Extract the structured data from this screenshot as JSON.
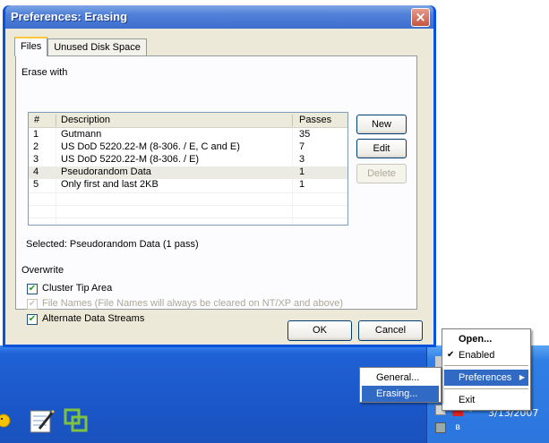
{
  "window": {
    "title": "Preferences: Erasing",
    "close_glyph": "×"
  },
  "tabs": [
    {
      "label": "Files",
      "active": true
    },
    {
      "label": "Unused Disk Space",
      "active": false
    }
  ],
  "erase_with": {
    "group_label": "Erase with",
    "columns": [
      "#",
      "Description",
      "Passes"
    ],
    "rows": [
      {
        "num": "1",
        "description": "Gutmann",
        "passes": "35",
        "selected": false
      },
      {
        "num": "2",
        "description": "US DoD 5220.22-M (8-306. / E, C and E)",
        "passes": "7",
        "selected": false
      },
      {
        "num": "3",
        "description": "US DoD 5220.22-M (8-306. / E)",
        "passes": "3",
        "selected": false
      },
      {
        "num": "4",
        "description": "Pseudorandom Data",
        "passes": "1",
        "selected": true
      },
      {
        "num": "5",
        "description": "Only first and last 2KB",
        "passes": "1",
        "selected": false
      }
    ],
    "selected_text": "Selected: Pseudorandom Data (1 pass)",
    "buttons": {
      "new": "New",
      "edit": "Edit",
      "delete": "Delete"
    }
  },
  "overwrite": {
    "group_label": "Overwrite",
    "options": [
      {
        "label": "Cluster Tip Area",
        "checked": true,
        "enabled": true
      },
      {
        "label": "File Names (File Names will always be cleared on NT/XP and above)",
        "checked": true,
        "enabled": false
      },
      {
        "label": "Alternate Data Streams",
        "checked": true,
        "enabled": true
      }
    ]
  },
  "dialog_buttons": {
    "ok": "OK",
    "cancel": "Cancel"
  },
  "tray_menu": {
    "items": [
      "Open...",
      "Enabled",
      "Preferences",
      "Exit"
    ],
    "check_glyph": "✔",
    "submenu_glyph": "▶"
  },
  "preferences_submenu": {
    "items": [
      "General...",
      "Erasing..."
    ]
  },
  "taskbar": {
    "clock": "3/13/2007",
    "check_glyph": "✓"
  },
  "colors": {
    "taskbar": "#1f62d6",
    "title_bar": "#4f7fd8",
    "menu_highlight": "#316ac5",
    "dialog_face": "#ece9d8"
  }
}
